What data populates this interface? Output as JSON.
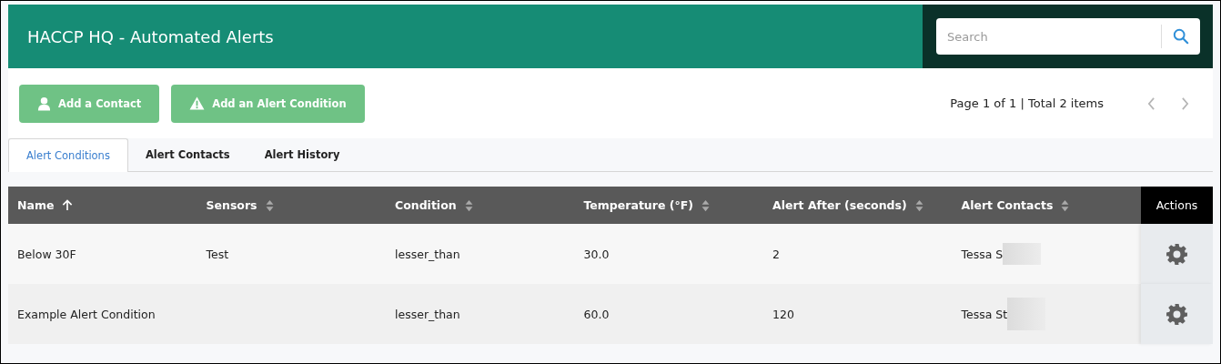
{
  "header": {
    "title": "HACCP HQ - Automated Alerts"
  },
  "search": {
    "placeholder": "Search"
  },
  "actions": [
    {
      "label": "Add a Contact",
      "kind": "person"
    },
    {
      "label": "Add an Alert Condition",
      "kind": "warning"
    }
  ],
  "pagination": {
    "summary": "Page 1 of 1 | Total 2 items"
  },
  "tabs": [
    {
      "label": "Alert Conditions",
      "selected": true
    },
    {
      "label": "Alert Contacts",
      "selected": false
    },
    {
      "label": "Alert History",
      "selected": false
    }
  ],
  "table": {
    "columns": [
      {
        "label": "Name",
        "sorted": true
      },
      {
        "label": "Sensors",
        "sorted": false
      },
      {
        "label": "Condition",
        "sorted": false
      },
      {
        "label": "Temperature (°F)",
        "sorted": false
      },
      {
        "label": "Alert After (seconds)",
        "sorted": false
      },
      {
        "label": "Alert Contacts",
        "sorted": false
      }
    ],
    "actions_label": "Actions",
    "rows": [
      {
        "cells": [
          "Below 30F",
          "Test",
          "lesser_than",
          "30.0",
          "2",
          "Tessa S"
        ],
        "redacted": true
      },
      {
        "cells": [
          "Example Alert Condition",
          "",
          "lesser_than",
          "60.0",
          "120",
          "Tessa St"
        ],
        "redacted": true
      }
    ]
  }
}
